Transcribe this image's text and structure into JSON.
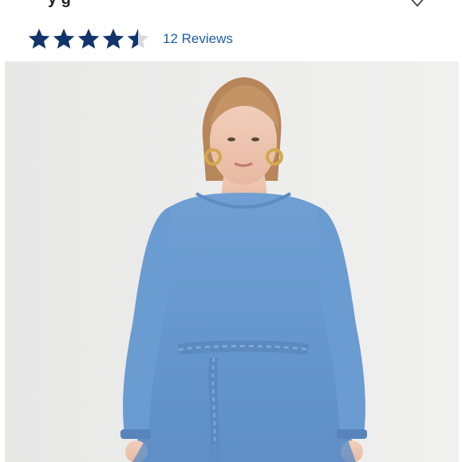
{
  "product": {
    "title_fragment": "y       g",
    "reviews_label": "12 Reviews",
    "rating": 4.5,
    "max_rating": 5
  },
  "icons": {
    "star": "star-icon",
    "favorite": "heart-icon"
  },
  "colors": {
    "star_fill": "#12346b",
    "star_empty": "#d6d9df",
    "link": "#1f5fa8",
    "photo_bg": "#ececeb"
  }
}
